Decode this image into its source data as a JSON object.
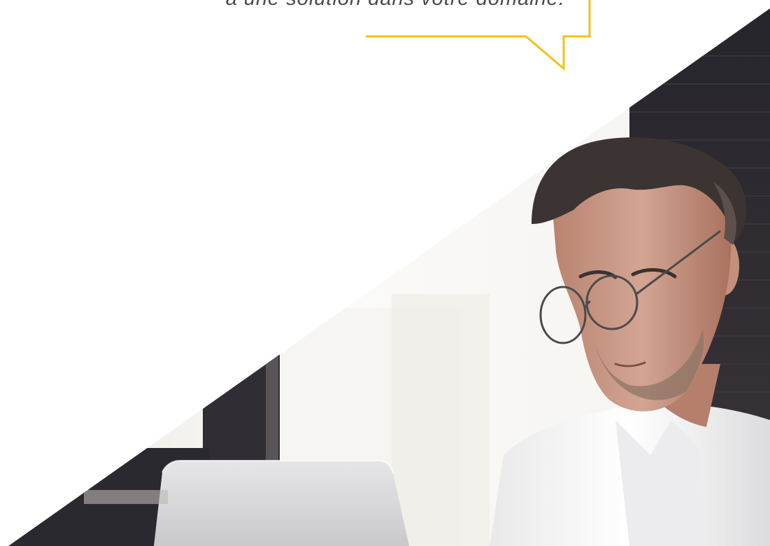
{
  "quote": {
    "text": "à une solution dans votre domaine."
  },
  "colors": {
    "accent": "#f2c318",
    "text": "#4a4a4a",
    "brick": "#2e2c33",
    "window": "#f3f2ee",
    "skin": "#c79a85",
    "hair": "#3a3331",
    "shirt": "#f4f4f4",
    "laptop": "#d9d9db"
  },
  "photo": {
    "subject": "man-with-glasses-using-laptop"
  }
}
